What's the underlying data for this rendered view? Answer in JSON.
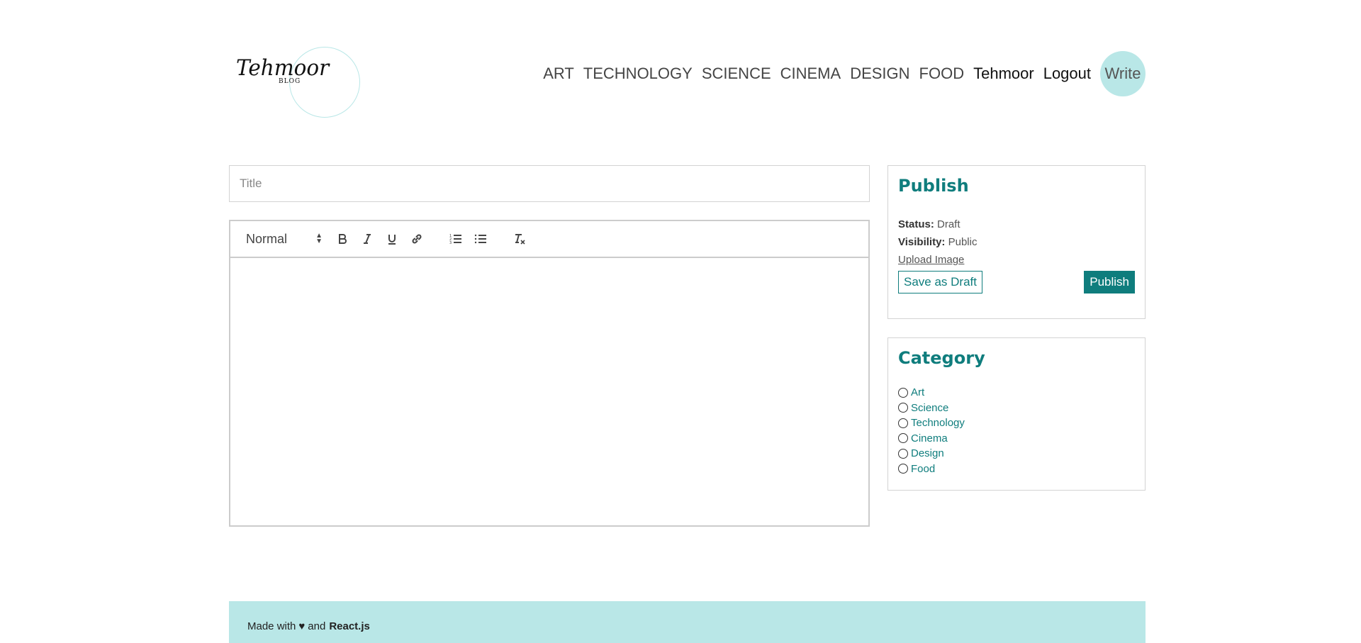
{
  "logo": {
    "script": "Tehmoor",
    "sub": "BLOG"
  },
  "nav": {
    "categories": [
      "ART",
      "TECHNOLOGY",
      "SCIENCE",
      "CINEMA",
      "DESIGN",
      "FOOD"
    ],
    "user": "Tehmoor",
    "logout": "Logout",
    "write": "Write"
  },
  "editor": {
    "title_placeholder": "Title",
    "format_select": "Normal"
  },
  "publish": {
    "heading": "Publish",
    "status_label": "Status:",
    "status_value": "Draft",
    "visibility_label": "Visibility:",
    "visibility_value": "Public",
    "upload": "Upload Image",
    "save_draft": "Save as Draft",
    "publish": "Publish"
  },
  "category": {
    "heading": "Category",
    "items": [
      "Art",
      "Science",
      "Technology",
      "Cinema",
      "Design",
      "Food"
    ]
  },
  "footer": {
    "prefix": "Made with",
    "heart": "♥",
    "and": "and",
    "tech": "React.js"
  },
  "colors": {
    "accent": "#0f7d7d",
    "light": "#b9e7e7"
  }
}
